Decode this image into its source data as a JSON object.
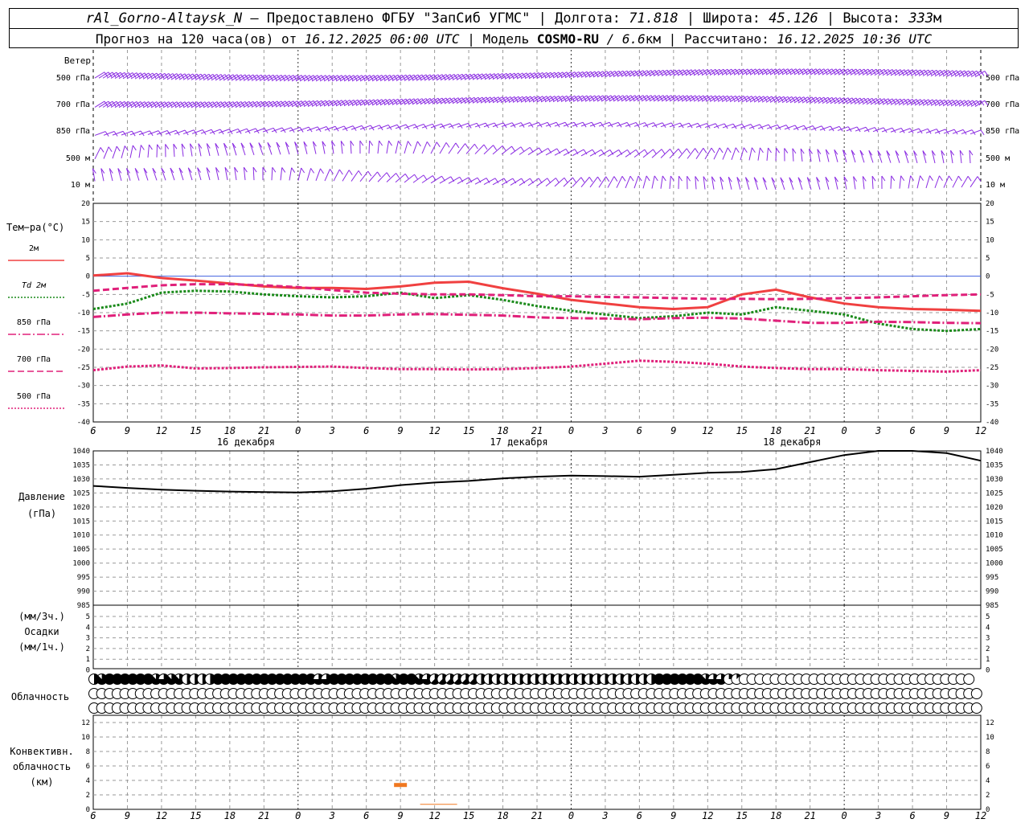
{
  "header": {
    "station": "rAl_Gorno-Altaysk_N",
    "dash": " — ",
    "provider": "Предоставлено ФГБУ \"ЗапСиб УГМС\"",
    "sep": " | ",
    "lon_label": "Долгота: ",
    "lon_value": "71.818",
    "lat_label": "Широта: ",
    "lat_value": "45.126",
    "alt_label": "Высота: ",
    "alt_value": "333",
    "alt_unit": "м",
    "forecast_label": "Прогноз на 120 часа(ов) от ",
    "forecast_time": "16.12.2025 06:00 UTC",
    "model_label": "Модель ",
    "model_name": "COSMO-RU",
    "model_res": " / 6.6",
    "model_res_unit": "км",
    "calc_label": "Рассчитано: ",
    "calc_time": "16.12.2025 10:36 UTC"
  },
  "wind_panel": {
    "title": "Ветер",
    "levels": [
      "500 гПа",
      "700 гПа",
      "850 гПа",
      "500 м",
      "10 м"
    ],
    "color": "#8a2be2"
  },
  "temp_panel": {
    "title": "Тем−ра(°C)",
    "legend": [
      {
        "label": "2м",
        "color": "#f04040",
        "style": "solid"
      },
      {
        "label": "Td 2м",
        "color": "#1a8a1a",
        "style": "dotted"
      },
      {
        "label": "850 гПа",
        "color": "#e0207a",
        "style": "dashdot"
      },
      {
        "label": "700 гПа",
        "color": "#e0207a",
        "style": "dashed"
      },
      {
        "label": "500 гПа",
        "color": "#e0207a",
        "style": "dotted"
      }
    ],
    "ticks": [
      "20",
      "15",
      "10",
      "5",
      "0",
      "-5",
      "-10",
      "-15",
      "-20",
      "-25",
      "-30",
      "-35",
      "-40"
    ]
  },
  "pressure_panel": {
    "title": "Давление",
    "unit": "(гПа)",
    "ticks": [
      "1040",
      "1035",
      "1030",
      "1025",
      "1020",
      "1015",
      "1010",
      "1005",
      "1000",
      "995",
      "990",
      "985"
    ]
  },
  "precip_panel": {
    "label1": "(мм/3ч.)",
    "label2": "Осадки",
    "label3": "(мм/1ч.)",
    "ticks": [
      "5",
      "4",
      "3",
      "2",
      "1",
      "0"
    ]
  },
  "cloud_panel": {
    "title": "Облачность",
    "rows": [
      "4,7,8,8,8,8,8,8,7,6,7,7,4,4,4,4,8,8,8,8,8,8,8,8,8,8,8,8,8,6,6,8,8,8,8,8,8,8,8,7,8,8,7,6,5,5,5,5,5,5,4,4,4,4,4,4,4,4,4,4,4,4,4,4,4,4,4,4,4,4,4,4,4,8,8,8,8,8,8,7,6,6,2,1,0,0,0,0,0,0,0,0,0,0,0,0,0,0,0,0,0,0,0,0,0,0,0,0,0,0,0,0,0,0",
      "0,0,0,0,0,0,0,0,0,0,0,0,0,0,0,0,0,0,0,0,0,0,0,0,0,0,0,0,0,0,0,0,0,0,0,0,0,0,0,0,0,0,0,0,0,0,0,0,0,0,0,0,0,0,0,0,0,0,0,0,0,0,0,0,0,0,0,0,0,0,0,0,0,0,0,0,0,0,0,0,0,0,0,0,0,0,0,0,0,0,0,0,0,0,0,0,0,0,0,0,0,0,0,0,0,0,0,0,0,0,0,0,0,0,0",
      "0,0,0,0,0,0,0,0,0,0,0,0,0,0,0,0,0,0,0,0,0,0,0,0,0,0,0,0,0,0,0,0,0,0,0,0,0,0,0,0,0,0,0,0,0,0,0,0,0,0,0,0,0,0,0,0,0,0,0,0,0,0,0,0,0,0,0,0,0,0,0,0,0,0,0,0,0,0,0,0,0,0,0,0,0,0,0,0,0,0,0,0,0,0,0,0,0,0,0,0,0,0,0,0,0,0,0,0,0,0,0,0,0,0,0"
    ]
  },
  "conv_panel": {
    "label1": "Конвективн.",
    "label2": "облачность",
    "label3": "(км)",
    "ticks": [
      "12",
      "10",
      "8",
      "6",
      "4",
      "2",
      "0"
    ]
  },
  "x_ticks": [
    "6",
    "9",
    "12",
    "15",
    "18",
    "21",
    "0",
    "3",
    "6",
    "9",
    "12",
    "15",
    "18",
    "21",
    "0",
    "3",
    "6",
    "9",
    "12",
    "15",
    "18",
    "21",
    "0",
    "3",
    "6",
    "9",
    "12"
  ],
  "day_labels": [
    "16 декабря",
    "17 декабря",
    "18 декабря"
  ],
  "chart_data": [
    {
      "type": "line",
      "title": "Тем−ра(°C)",
      "x_unit": "hours since 16.12.2025 06:00 UTC",
      "ylim": [
        -40,
        20
      ],
      "x": [
        0,
        3,
        6,
        9,
        12,
        15,
        18,
        21,
        24,
        27,
        30,
        33,
        36,
        39,
        42,
        45,
        48,
        51,
        54,
        57,
        60,
        63,
        66,
        69,
        72,
        75,
        78
      ],
      "series": [
        {
          "name": "2м",
          "values": [
            0.2,
            0.8,
            -0.5,
            -1.2,
            -2,
            -2.8,
            -3.2,
            -3.2,
            -3.5,
            -2.8,
            -1.8,
            -1.5,
            -3.3,
            -4.8,
            -6.5,
            -7.5,
            -8.5,
            -9,
            -8.5,
            -5,
            -3.7,
            -5.8,
            -7.5,
            -8.5,
            -9,
            -9.2,
            -9.5
          ]
        },
        {
          "name": "Td 2м",
          "values": [
            -9,
            -7.5,
            -4.5,
            -4,
            -4.2,
            -5,
            -5.5,
            -5.8,
            -5.5,
            -4.5,
            -6,
            -5.2,
            -6.5,
            -8.2,
            -9.5,
            -10.5,
            -11.5,
            -11,
            -10,
            -10.5,
            -8.5,
            -9.5,
            -10.5,
            -13,
            -14.5,
            -15,
            -14.5
          ]
        },
        {
          "name": "850 гПа",
          "values": [
            -11.2,
            -10.5,
            -10,
            -10,
            -10.2,
            -10.3,
            -10.5,
            -10.8,
            -10.8,
            -10.5,
            -10.4,
            -10.6,
            -10.8,
            -11.3,
            -11.5,
            -11.6,
            -11.8,
            -11.5,
            -11.4,
            -11.6,
            -12.2,
            -12.8,
            -12.8,
            -12.5,
            -12.6,
            -12.8,
            -12.9
          ]
        },
        {
          "name": "700 гПа",
          "values": [
            -4,
            -3.2,
            -2.5,
            -2.2,
            -2.2,
            -2.5,
            -3,
            -3.8,
            -4.5,
            -4.8,
            -5,
            -5,
            -5.2,
            -5.5,
            -5.5,
            -5.7,
            -5.8,
            -6,
            -6.2,
            -6.2,
            -6.3,
            -6.2,
            -6,
            -5.8,
            -5.5,
            -5.2,
            -5
          ]
        },
        {
          "name": "500 гПа",
          "values": [
            -25.8,
            -24.8,
            -24.5,
            -25.3,
            -25.2,
            -25,
            -24.9,
            -24.8,
            -25.2,
            -25.5,
            -25.5,
            -25.6,
            -25.5,
            -25.2,
            -24.8,
            -24,
            -23.2,
            -23.5,
            -24,
            -24.8,
            -25.2,
            -25.5,
            -25.5,
            -25.8,
            -26,
            -26.2,
            -25.8
          ]
        }
      ]
    },
    {
      "type": "line",
      "title": "Давление",
      "ylabel": "(гПа)",
      "x_unit": "hours since 16.12.2025 06:00 UTC",
      "ylim": [
        985,
        1040
      ],
      "x": [
        0,
        3,
        6,
        9,
        12,
        15,
        18,
        21,
        24,
        27,
        30,
        33,
        36,
        39,
        42,
        45,
        48,
        51,
        54,
        57,
        60,
        63,
        66,
        69,
        72,
        75,
        78
      ],
      "series": [
        {
          "name": "Давление",
          "values": [
            1027.5,
            1026.8,
            1026.2,
            1025.8,
            1025.5,
            1025.3,
            1025.2,
            1025.6,
            1026.5,
            1027.8,
            1028.7,
            1029.3,
            1030.2,
            1030.8,
            1031.2,
            1031.0,
            1030.8,
            1031.5,
            1032.2,
            1032.5,
            1033.5,
            1036.0,
            1038.5,
            1040.0,
            1040.0,
            1039.2,
            1036.5
          ]
        }
      ]
    },
    {
      "type": "bar",
      "title": "Конвективн. облачность",
      "ylabel": "(км)",
      "ylim": [
        0,
        13
      ],
      "x": [
        27,
        30
      ],
      "series": [
        {
          "values": [
            3.2,
            0.7
          ]
        }
      ]
    }
  ]
}
